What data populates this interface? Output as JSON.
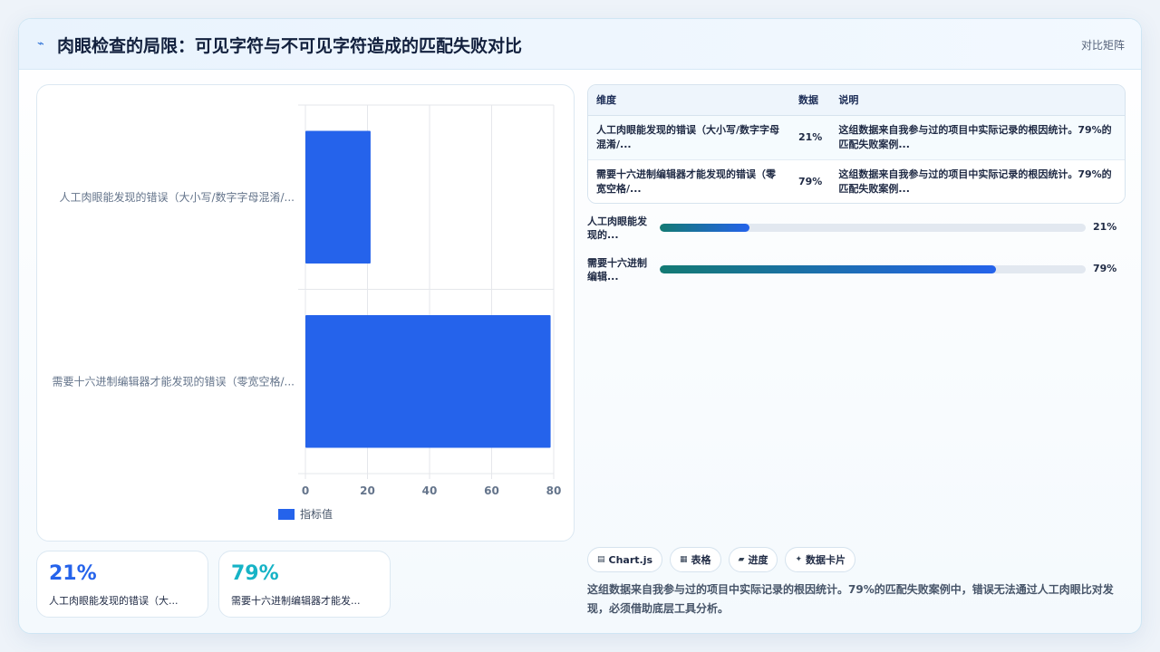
{
  "header": {
    "title": "肉眼检查的局限：可见字符与不可见字符造成的匹配失败对比",
    "tag": "对比矩阵"
  },
  "colors": {
    "bar": "#2563eb",
    "kpi1": "#2563eb",
    "kpi2": "#16b3c6",
    "progress_start": "#137a73",
    "progress_end": "#2563eb"
  },
  "chart_data": {
    "type": "bar",
    "orientation": "horizontal",
    "categories": [
      "人工肉眼能发现的错误（大小写/数字字母混淆/...",
      "需要十六进制编辑器才能发现的错误（零宽空格/..."
    ],
    "series": [
      {
        "name": "指标值",
        "values": [
          21,
          79
        ]
      }
    ],
    "xlim": [
      0,
      80
    ],
    "xticks": [
      0,
      20,
      40,
      60,
      80
    ],
    "grid": true,
    "legend": "bottom"
  },
  "kpis": [
    {
      "value": "21%",
      "label": "人工肉眼能发现的错误（大..."
    },
    {
      "value": "79%",
      "label": "需要十六进制编辑器才能发..."
    }
  ],
  "table": {
    "headers": [
      "维度",
      "数据",
      "说明"
    ],
    "rows": [
      {
        "dim": "人工肉眼能发现的错误（大小写/数字字母混淆/...",
        "val": "21%",
        "desc": "这组数据来自我参与过的项目中实际记录的根因统计。79%的匹配失败案例..."
      },
      {
        "dim": "需要十六进制编辑器才能发现的错误（零宽空格/...",
        "val": "79%",
        "desc": "这组数据来自我参与过的项目中实际记录的根因统计。79%的匹配失败案例..."
      }
    ]
  },
  "progress": [
    {
      "label": "人工肉眼能发现的...",
      "value": 21,
      "pct": "21%"
    },
    {
      "label": "需要十六进制编辑...",
      "value": 79,
      "pct": "79%"
    }
  ],
  "chips": [
    {
      "icon": "chart-icon",
      "glyph": "▤",
      "label": "Chart.js"
    },
    {
      "icon": "table-icon",
      "glyph": "▦",
      "label": "表格"
    },
    {
      "icon": "progress-icon",
      "glyph": "▰",
      "label": "进度"
    },
    {
      "icon": "card-icon",
      "glyph": "✦",
      "label": "数据卡片"
    }
  ],
  "note": "这组数据来自我参与过的项目中实际记录的根因统计。79%的匹配失败案例中，错误无法通过人工肉眼比对发现，必须借助底层工具分析。"
}
